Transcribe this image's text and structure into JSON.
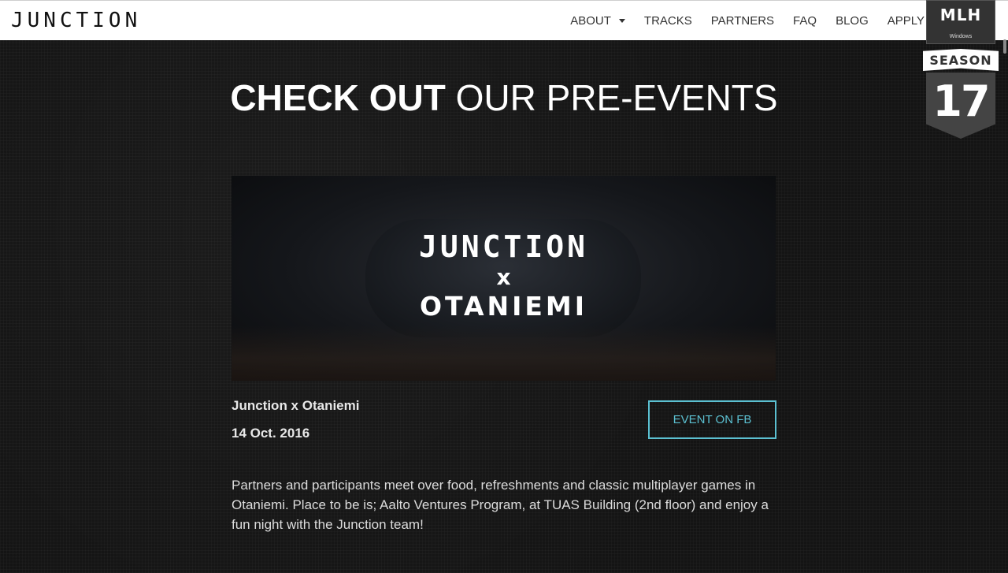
{
  "navbar": {
    "brand": "JUNCTION",
    "items": [
      {
        "label": "ABOUT",
        "has_dropdown": true
      },
      {
        "label": "TRACKS"
      },
      {
        "label": "PARTNERS"
      },
      {
        "label": "FAQ"
      },
      {
        "label": "BLOG"
      },
      {
        "label": "APPLY"
      }
    ]
  },
  "mlh_badge": {
    "title": "MLH",
    "sponsors": "Windows",
    "season_label": "SEASON",
    "season_number": "17"
  },
  "section": {
    "heading_bold": "CHECK OUT",
    "heading_light": "OUR PRE-EVENTS"
  },
  "event": {
    "image_lines": [
      "JUNCTION",
      "x",
      "OTANIEMI"
    ],
    "name": "Junction x Otaniemi",
    "date": "14 Oct. 2016",
    "button_label": "EVENT ON FB",
    "description": "Partners and participants meet over food, refreshments and classic multiplayer games in Otaniemi. Place to be is; Aalto Ventures Program, at TUAS Building (2nd floor) and enjoy a fun night with the Junction team!"
  },
  "colors": {
    "accent": "#5bc0d1",
    "background": "#141414",
    "navbar": "#ffffff"
  }
}
